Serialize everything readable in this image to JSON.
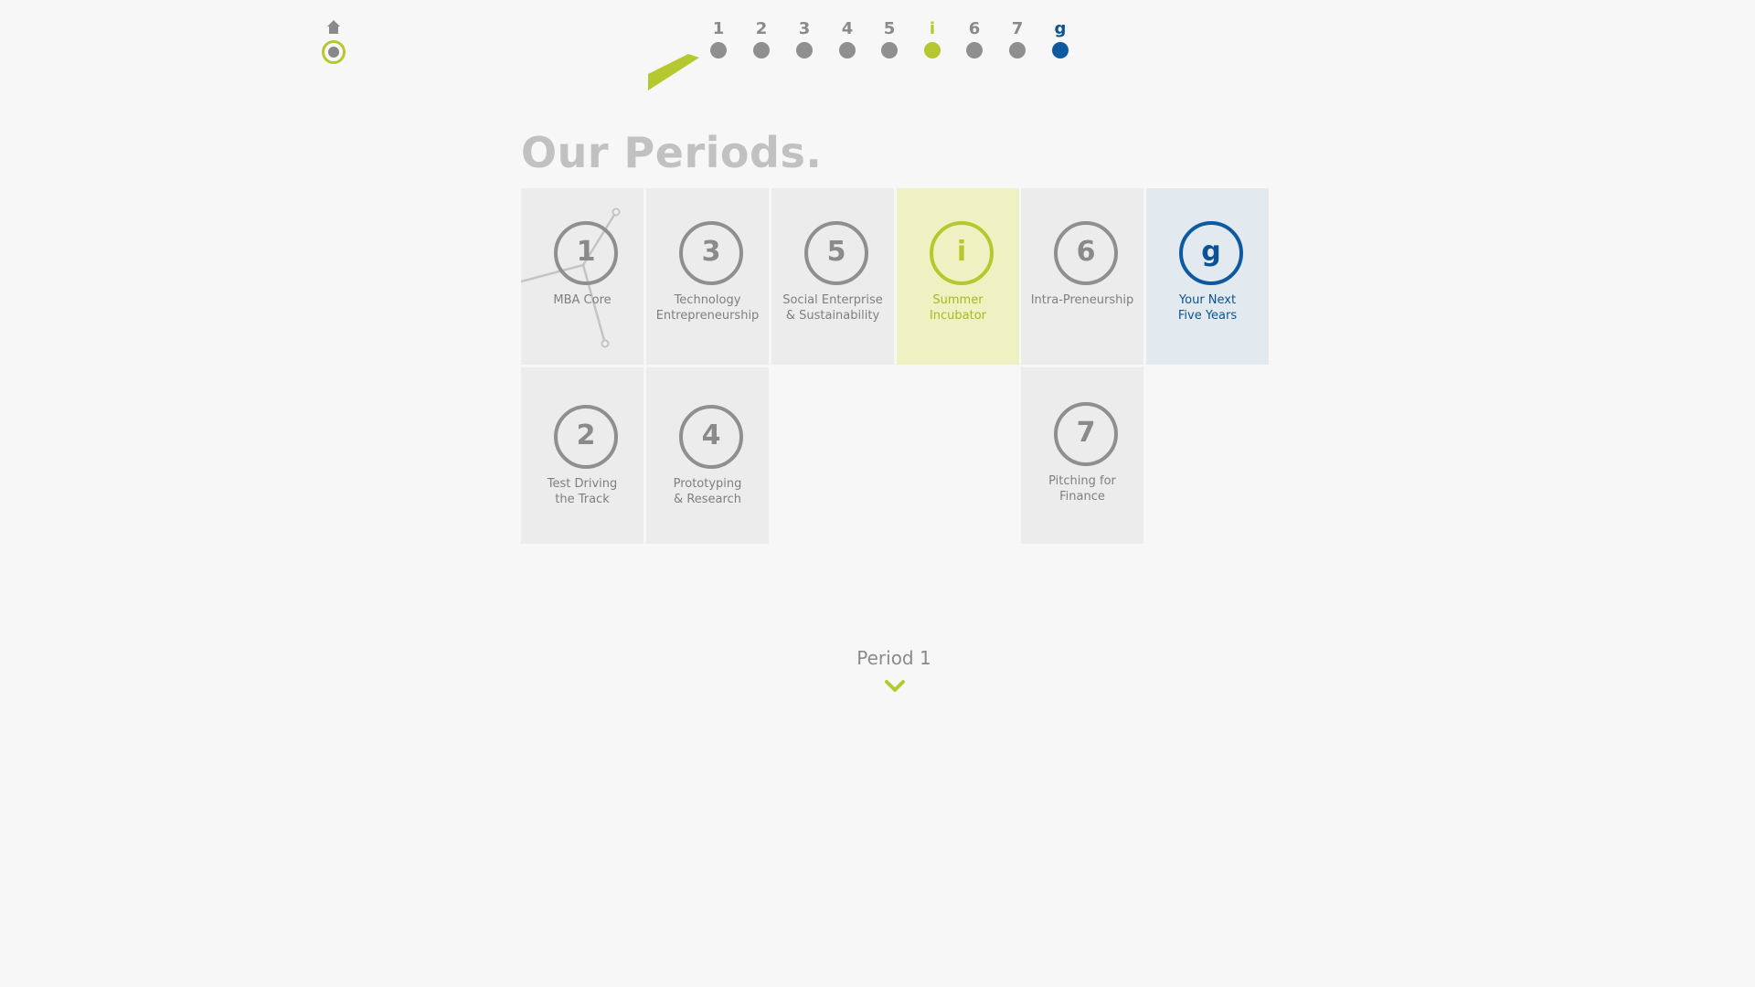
{
  "page": {
    "title": "Our Periods.",
    "current_period_label": "Period 1"
  },
  "colors": {
    "accent_lime": "#b6c82f",
    "accent_blue": "#0d5aa3",
    "neutral_grey": "#8f8f8f",
    "title_grey": "#c1c1c1"
  },
  "icons": {
    "home": "home-icon",
    "chevron": "chevron-down-icon"
  },
  "timeline": [
    {
      "label": "1",
      "state": "default"
    },
    {
      "label": "2",
      "state": "default"
    },
    {
      "label": "3",
      "state": "default"
    },
    {
      "label": "4",
      "state": "default"
    },
    {
      "label": "5",
      "state": "default"
    },
    {
      "label": "i",
      "state": "lime"
    },
    {
      "label": "6",
      "state": "default"
    },
    {
      "label": "7",
      "state": "default"
    },
    {
      "label": "g",
      "state": "blue"
    }
  ],
  "tiles": [
    {
      "number": "1",
      "label": "MBA Core"
    },
    {
      "number": "3",
      "label": "Technology\nEntrepreneurship"
    },
    {
      "number": "5",
      "label": "Social Enterprise\n& Sustainability"
    },
    {
      "number": "i",
      "label": "Summer\nIncubator"
    },
    {
      "number": "6",
      "label": "Intra-Preneurship"
    },
    {
      "number": "g",
      "label": "Your Next\nFive Years"
    },
    {
      "number": "2",
      "label": "Test Driving\nthe Track"
    },
    {
      "number": "4",
      "label": "Prototyping\n& Research"
    },
    {
      "number": "7",
      "label": "Pitching for\nFinance"
    }
  ]
}
